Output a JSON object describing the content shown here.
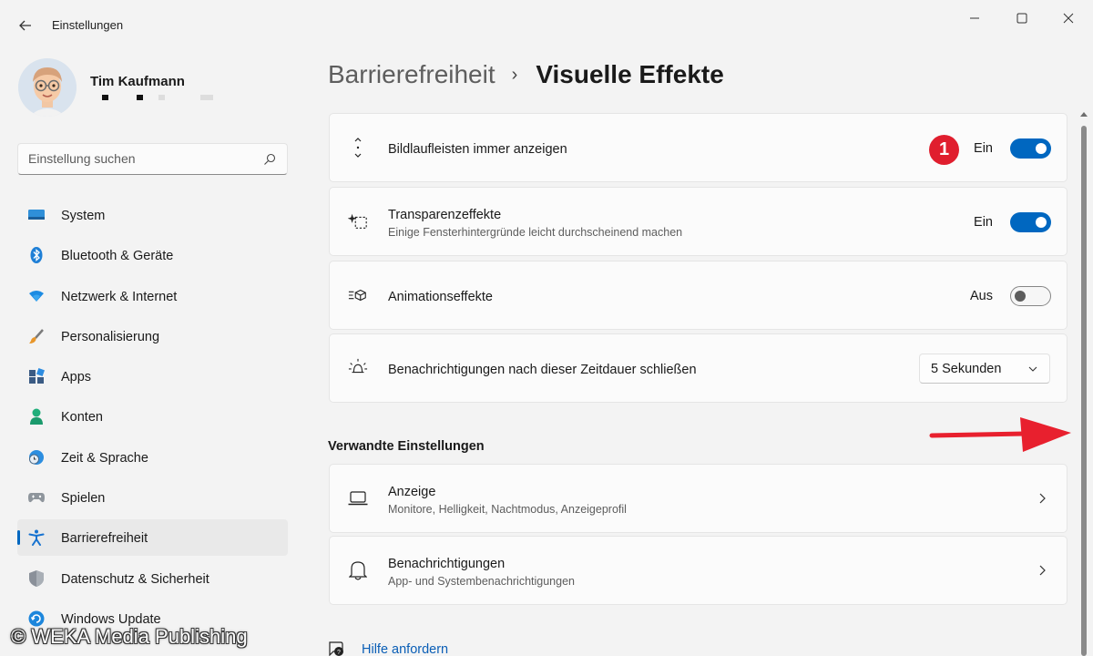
{
  "window": {
    "title": "Einstellungen",
    "back_icon": "back-arrow-icon",
    "controls": [
      "minimize-icon",
      "maximize-icon",
      "close-icon"
    ]
  },
  "profile": {
    "name": "Tim Kaufmann"
  },
  "search": {
    "placeholder": "Einstellung suchen"
  },
  "sidebar": {
    "items": [
      {
        "label": "System",
        "icon": "system-icon"
      },
      {
        "label": "Bluetooth & Geräte",
        "icon": "bluetooth-icon"
      },
      {
        "label": "Netzwerk & Internet",
        "icon": "wifi-icon"
      },
      {
        "label": "Personalisierung",
        "icon": "brush-icon"
      },
      {
        "label": "Apps",
        "icon": "apps-icon"
      },
      {
        "label": "Konten",
        "icon": "account-icon"
      },
      {
        "label": "Zeit & Sprache",
        "icon": "clock-globe-icon"
      },
      {
        "label": "Spielen",
        "icon": "gamepad-icon"
      },
      {
        "label": "Barrierefreiheit",
        "icon": "accessibility-icon",
        "active": true
      },
      {
        "label": "Datenschutz & Sicherheit",
        "icon": "shield-icon"
      },
      {
        "label": "Windows Update",
        "icon": "update-icon"
      }
    ]
  },
  "breadcrumb": {
    "parent": "Barrierefreiheit",
    "separator": "›",
    "current": "Visuelle Effekte"
  },
  "settings": {
    "scrollbars": {
      "title": "Bildlaufleisten immer anzeigen",
      "state": "Ein",
      "on": true,
      "badge": "1",
      "icon": "scrollbar-arrows-icon"
    },
    "transparency": {
      "title": "Transparenzeffekte",
      "subtitle": "Einige Fensterhintergründe leicht durchscheinend machen",
      "state": "Ein",
      "on": true,
      "icon": "transparency-sparkle-icon"
    },
    "animation": {
      "title": "Animationseffekte",
      "state": "Aus",
      "on": false,
      "icon": "animation-icon"
    },
    "notifications_timeout": {
      "title": "Benachrichtigungen nach dieser Zeitdauer schließen",
      "value": "5 Sekunden",
      "icon": "sun-bell-icon"
    }
  },
  "related": {
    "heading": "Verwandte Einstellungen",
    "items": [
      {
        "title": "Anzeige",
        "subtitle": "Monitore, Helligkeit, Nachtmodus, Anzeigeprofil",
        "icon": "laptop-icon"
      },
      {
        "title": "Benachrichtigungen",
        "subtitle": "App- und Systembenachrichtigungen",
        "icon": "bell-icon"
      }
    ]
  },
  "help": {
    "label": "Hilfe anfordern",
    "icon": "help-chat-icon"
  },
  "watermark": "© WEKA Media Publishing",
  "colors": {
    "accent": "#0067c0",
    "badge": "#e01e2e",
    "annotation_arrow": "#e8202e",
    "background": "#f3f3f3"
  }
}
